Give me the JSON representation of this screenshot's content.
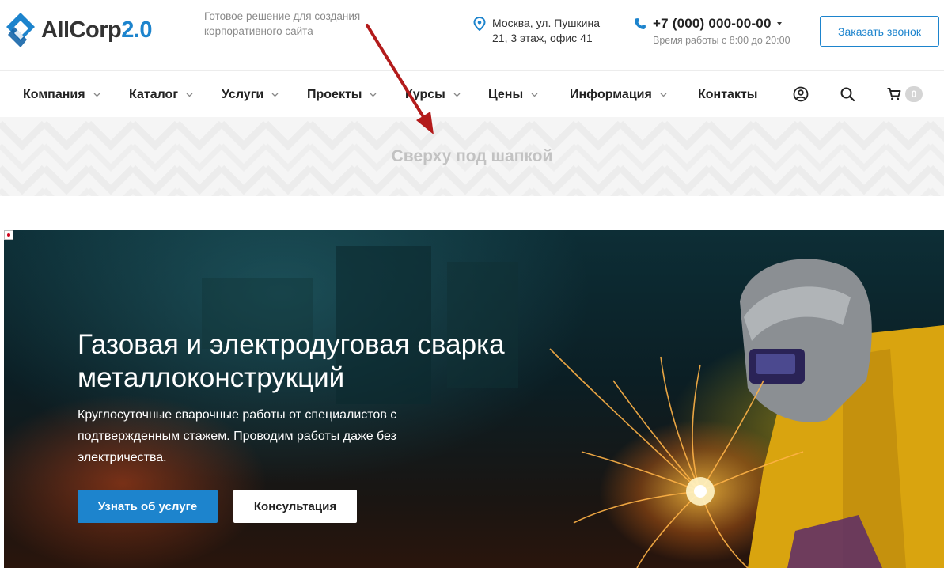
{
  "header": {
    "logo": {
      "name": "AllCorp",
      "version": "2.0"
    },
    "slogan": "Готовое решение для создания корпоративного сайта",
    "address": {
      "line1": "Москва, ул. Пушкина",
      "line2": "21, 3 этаж, офис 41"
    },
    "phone": {
      "number": "+7 (000) 000-00-00",
      "hours": "Время работы с 8:00 до 20:00"
    },
    "callback_label": "Заказать звонок"
  },
  "nav": {
    "items": [
      {
        "label": "Компания",
        "has_dropdown": true
      },
      {
        "label": "Каталог",
        "has_dropdown": true
      },
      {
        "label": "Услуги",
        "has_dropdown": true
      },
      {
        "label": "Проекты",
        "has_dropdown": true
      },
      {
        "label": "Курсы",
        "has_dropdown": true
      },
      {
        "label": "Цены",
        "has_dropdown": true
      },
      {
        "label": "Информация",
        "has_dropdown": true
      },
      {
        "label": "Контакты",
        "has_dropdown": false
      }
    ],
    "icons": [
      "user-icon",
      "search-icon",
      "cart-icon"
    ],
    "cart_count": "0"
  },
  "banner_strip": {
    "text": "Сверху под шапкой"
  },
  "hero": {
    "title": "Газовая и электродуговая сварка металлоконструкций",
    "description": "Круглосуточные сварочные работы от специалистов с подтвержденным стажем. Проводим работы даже без электричества.",
    "primary_button": "Узнать об услуге",
    "secondary_button": "Консультация"
  },
  "colors": {
    "accent": "#1d84cd",
    "arrow": "#b31b1b",
    "strip_bg": "#f5f5f5",
    "strip_text": "#c2c2c2"
  }
}
